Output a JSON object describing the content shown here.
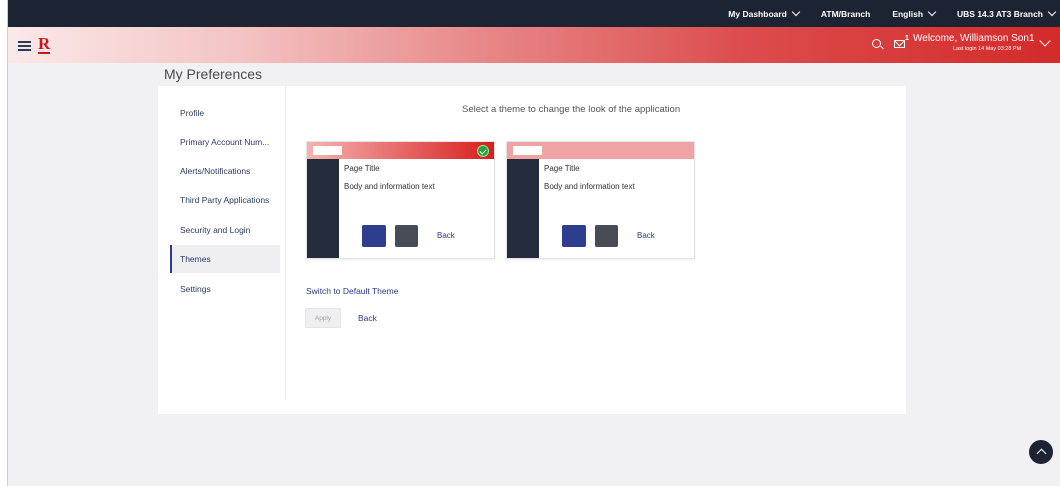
{
  "topbar": {
    "dashboard": "My Dashboard",
    "atm": "ATM/Branch",
    "language": "English",
    "branch": "UBS 14.3 AT3 Branch"
  },
  "header": {
    "logo": "R",
    "mail_count": "1",
    "welcome": "Welcome, Williamson Son1",
    "last_login": "Last login 14 May 03:28 PM"
  },
  "page": {
    "title": "My Preferences"
  },
  "nav": {
    "items": [
      "Profile",
      "Primary Account Num...",
      "Alerts/Notifications",
      "Third Party Applications",
      "Security and Login",
      "Themes",
      "Settings"
    ],
    "active": "Themes"
  },
  "themes": {
    "heading": "Select a theme to change the look of the application",
    "cards": [
      {
        "page_title": "Page Title",
        "body_text": "Body and information text",
        "back_label": "Back",
        "header_gradient_start": "#f5b3b3",
        "header_gradient_end": "#d81e1e",
        "selected": true
      },
      {
        "page_title": "Page Title",
        "body_text": "Body and information text",
        "back_label": "Back",
        "header_gradient_start": "#efa4a4",
        "header_gradient_end": "#efa4a4",
        "selected": false
      }
    ],
    "switch_default": "Switch to Default Theme",
    "apply_label": "Apply",
    "back_label": "Back"
  },
  "colors": {
    "topbar": "#1c2433",
    "accent_red": "#d42a2a",
    "link_blue": "#2a3a8c",
    "primary_button": "#2c3e8c",
    "secondary_button": "#474b55"
  }
}
